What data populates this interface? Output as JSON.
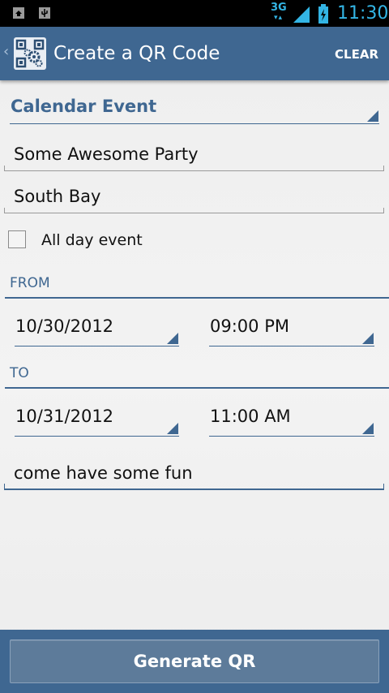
{
  "status_bar": {
    "network": "3G",
    "time": "11:30",
    "left_icons": [
      "notification-box-icon",
      "usb-icon"
    ]
  },
  "action_bar": {
    "title": "Create a QR Code",
    "clear_label": "CLEAR",
    "app_icon": "qr-gear-icon"
  },
  "form": {
    "type_spinner": "Calendar Event",
    "event_title": "Some Awesome Party",
    "location": "South Bay",
    "all_day_label": "All day event",
    "all_day_checked": false,
    "from_label": "FROM",
    "from_date": "10/30/2012",
    "from_time": "09:00 PM",
    "to_label": "TO",
    "to_date": "10/31/2012",
    "to_time": "11:00 AM",
    "description": "come have some fun"
  },
  "footer": {
    "generate_label": "Generate QR"
  },
  "colors": {
    "accent": "#3f6791",
    "status_blue": "#33b5e5",
    "button": "#5d7b9a",
    "background": "#eeeeee"
  }
}
